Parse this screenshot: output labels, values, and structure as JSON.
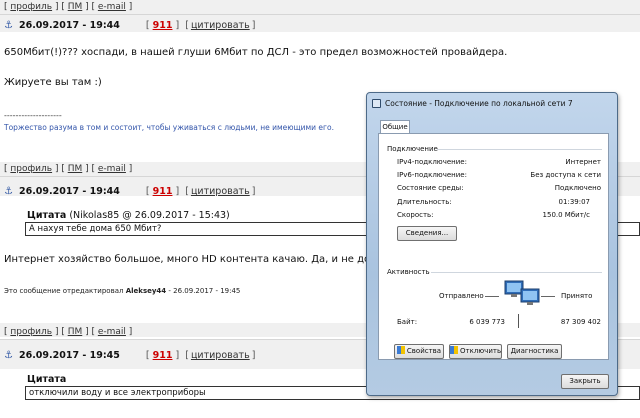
{
  "nav": {
    "profile": "профиль",
    "pm": "ПМ",
    "email": "e-mail"
  },
  "posts": [
    {
      "date": "26.09.2017 - 19:44",
      "num": "911",
      "cite": "цитировать",
      "line1": "650Мбит(!)??? хоспади, в нашей глуши 6Мбит по ДСЛ - это предел возможностей провайдера.",
      "line2": "Жируете вы там :)",
      "dashes": "--------------------",
      "signature": "Торжество разума в том и состоит, чтобы уживаться с людьми, не имеющими его."
    },
    {
      "date": "26.09.2017 - 19:44",
      "num": "911",
      "cite": "цитировать",
      "quote_label": "Цитата",
      "quote_meta": "(Nikolas85 @ 26.09.2017 - 15:43)",
      "quote_text": "А нахуя тебе дома 650 Мбит?",
      "line1": "Интернет хозяйство большое, много HD контента качаю. Да, и не дорого",
      "edited_prefix": "Это сообщение отредактировал",
      "edited_user": "Aleksey44",
      "edited_date": "- 26.09.2017 - 19:45"
    },
    {
      "date": "26.09.2017 - 19:45",
      "num": "911",
      "cite": "цитировать",
      "quote_label": "Цитата",
      "quote_text": "отключили воду и все электроприборы"
    }
  ],
  "dialog": {
    "title": "Состояние - Подключение по локальной сети 7",
    "tab": "Общие",
    "connection_group": "Подключение",
    "rows": [
      {
        "label": "IPv4-подключение:",
        "value": "Интернет"
      },
      {
        "label": "IPv6-подключение:",
        "value": "Без доступа к сети"
      },
      {
        "label": "Состояние среды:",
        "value": "Подключено"
      },
      {
        "label": "Длительность:",
        "value": "01:39:07"
      },
      {
        "label": "Скорость:",
        "value": "150.0 Мбит/с"
      }
    ],
    "details_button": "Сведения...",
    "activity_group": "Активность",
    "sent_label": "Отправлено",
    "received_label": "Принято",
    "bytes_label": "Байт:",
    "bytes_sent": "6 039 773",
    "bytes_received": "87 309 402",
    "properties_button": "Свойства",
    "disable_button": "Отключить",
    "diagnostics_button": "Диагностика",
    "close_button": "Закрыть"
  }
}
